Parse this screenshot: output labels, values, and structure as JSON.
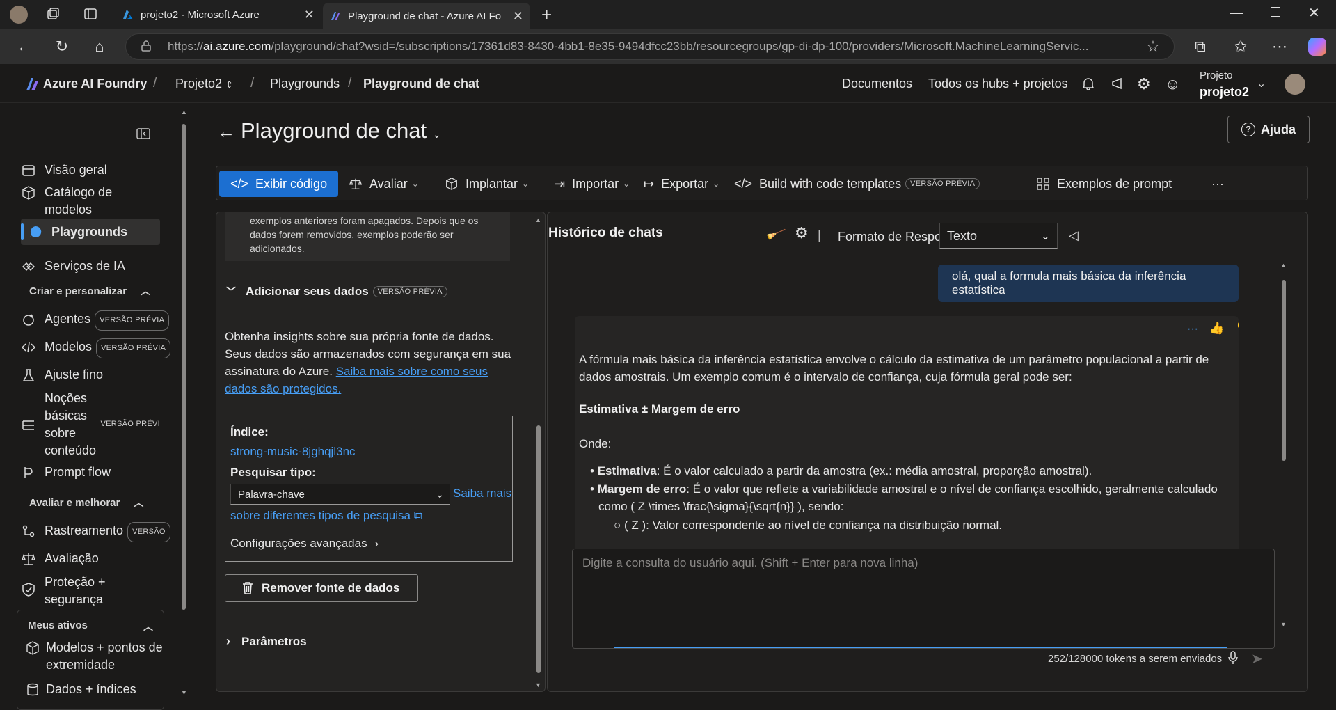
{
  "browser": {
    "tabs": [
      {
        "title": "projeto2 - Microsoft Azure"
      },
      {
        "title": "Playground de chat - Azure AI Fo"
      }
    ],
    "url_prefix": "https://",
    "url_host": "ai.azure.com",
    "url_rest": "/playground/chat?wsid=/subscriptions/17361d83-8430-4bb1-8e35-9494dfcc23bb/resourcegroups/gp-di-dp-100/providers/Microsoft.MachineLearningServic..."
  },
  "header": {
    "brand": "Azure AI Foundry",
    "crumb_project": "Projeto2",
    "crumb_playgrounds": "Playgrounds",
    "crumb_current": "Playground de chat",
    "docs": "Documentos",
    "hubs": "Todos os hubs + projetos",
    "project_label": "Projeto",
    "project_name": "projeto2"
  },
  "sidebar": {
    "items": [
      {
        "label": "Visão geral",
        "icon": "overview-icon"
      },
      {
        "label": "Catálogo de modelos",
        "icon": "cube-icon"
      },
      {
        "label": "Playgrounds",
        "icon": "chat-icon"
      },
      {
        "label": "Serviços de IA",
        "icon": "services-icon"
      }
    ],
    "section_create": "Criar e personalizar",
    "create_items": [
      {
        "label": "Agentes",
        "badge": "VERSÃO PRÉVIA"
      },
      {
        "label": "Modelos",
        "badge": "VERSÃO PRÉVIA"
      },
      {
        "label": "Ajuste fino"
      },
      {
        "label": "Noções básicas sobre conteúdo",
        "badge": "VERSÃO PRÉVI"
      },
      {
        "label": "Prompt flow"
      }
    ],
    "section_eval": "Avaliar e melhorar",
    "eval_items": [
      {
        "label": "Rastreamento",
        "badge": "VERSÃO"
      },
      {
        "label": "Avaliação"
      },
      {
        "label": "Proteção + segurança"
      }
    ],
    "section_assets": "Meus ativos",
    "asset_items": [
      {
        "label": "Modelos + pontos de extremidade"
      },
      {
        "label": "Dados + índices"
      }
    ]
  },
  "page": {
    "title": "Playground de chat",
    "help": "Ajuda"
  },
  "toolbar": {
    "view_code": "Exibir código",
    "evaluate": "Avaliar",
    "deploy": "Implantar",
    "import": "Importar",
    "export": "Exportar",
    "templates": "Build with code templates",
    "templates_badge": "VERSÃO PRÉVIA",
    "prompt_examples": "Exemplos de prompt",
    "more": "···"
  },
  "setup": {
    "info_text": "exemplos anteriores foram apagados. Depois que os dados forem removidos, exemplos poderão ser adicionados.",
    "add_data_title": "Adicionar seus dados",
    "add_data_badge": "VERSÃO PRÉVIA",
    "insights_text": "Obtenha insights sobre sua própria fonte de dados. Seus dados são armazenados com segurança em sua assinatura do Azure.",
    "insights_link": "Saiba mais sobre como seus dados são protegidos.",
    "index_label": "Índice:",
    "index_value": "strong-music-8jghqjl3nc",
    "search_type_label": "Pesquisar tipo:",
    "search_type_value": "Palavra-chave",
    "search_link_a": "Saiba mais",
    "search_link_b": "sobre diferentes tipos de pesquisa",
    "advanced": "Configurações avançadas",
    "remove": "Remover fonte de dados",
    "params": "Parâmetros"
  },
  "chat": {
    "history_title": "Histórico de chats",
    "response_format_label": "Formato de Resposta",
    "response_format_value": "Texto",
    "user_message": "olá, qual a formula mais básica da inferência estatística",
    "ai_p1": "A fórmula mais básica da inferência estatística envolve o cálculo da estimativa de um parâmetro populacional a partir de dados amostrais. Um exemplo comum é o intervalo de confiança, cuja fórmula geral pode ser:",
    "ai_formula": "Estimativa ± Margem de erro",
    "ai_where": "Onde:",
    "ai_b1_term": "Estimativa",
    "ai_b1_text": ": É o valor calculado a partir da amostra (ex.: média amostral, proporção amostral).",
    "ai_b2_term": "Margem de erro",
    "ai_b2_text": ": É o valor que reflete a variabilidade amostral e o nível de confiança escolhido, geralmente calculado como ( Z \\times \\frac{\\sigma}{\\sqrt{n}} ), sendo:",
    "ai_sub1": "( Z ): Valor correspondente ao nível de confiança na distribuição normal.",
    "input_placeholder": "Digite a consulta do usuário aqui. (Shift + Enter para nova linha)",
    "token_count": "252/128000 tokens a serem enviados"
  }
}
